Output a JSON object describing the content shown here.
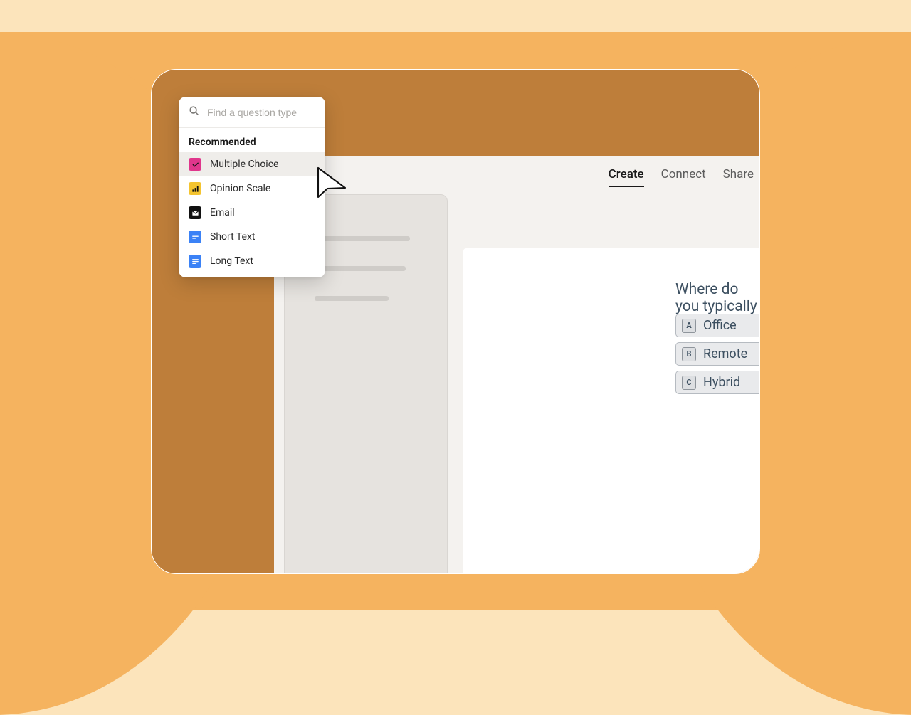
{
  "tabs": {
    "create": "Create",
    "connect": "Connect",
    "share": "Share"
  },
  "dropdown": {
    "search_placeholder": "Find a question type",
    "section_label": "Recommended",
    "items": {
      "multiple_choice": "Multiple Choice",
      "opinion_scale": "Opinion Scale",
      "email": "Email",
      "short_text": "Short Text",
      "long_text": "Long Text"
    }
  },
  "question": {
    "title": "Where do you typically work?",
    "options": [
      {
        "key": "A",
        "label": "Office"
      },
      {
        "key": "B",
        "label": "Remote"
      },
      {
        "key": "C",
        "label": "Hybrid"
      }
    ]
  }
}
